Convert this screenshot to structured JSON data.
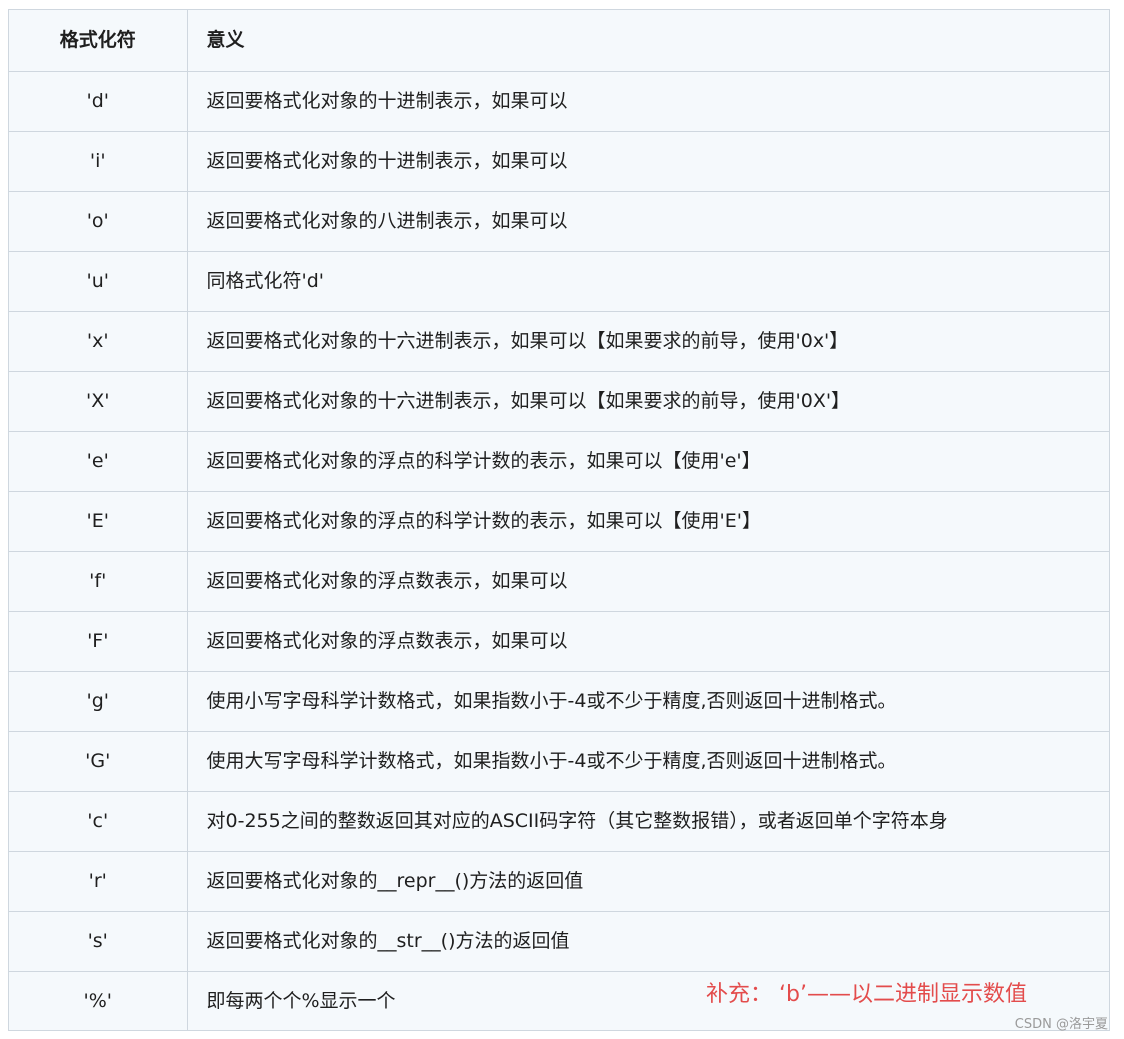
{
  "table": {
    "headers": {
      "format": "格式化符",
      "meaning": "意义"
    },
    "rows": [
      {
        "format": "'d'",
        "meaning": "返回要格式化对象的十进制表示，如果可以"
      },
      {
        "format": "'i'",
        "meaning": "返回要格式化对象的十进制表示，如果可以"
      },
      {
        "format": "'o'",
        "meaning": "返回要格式化对象的八进制表示，如果可以"
      },
      {
        "format": "'u'",
        "meaning": "同格式化符'd'"
      },
      {
        "format": "'x'",
        "meaning": "返回要格式化对象的十六进制表示，如果可以【如果要求的前导，使用'0x'】"
      },
      {
        "format": "'X'",
        "meaning": "返回要格式化对象的十六进制表示，如果可以【如果要求的前导，使用'0X'】"
      },
      {
        "format": "'e'",
        "meaning": "返回要格式化对象的浮点的科学计数的表示，如果可以【使用'e'】"
      },
      {
        "format": "'E'",
        "meaning": "返回要格式化对象的浮点的科学计数的表示，如果可以【使用'E'】"
      },
      {
        "format": "'f'",
        "meaning": "返回要格式化对象的浮点数表示，如果可以"
      },
      {
        "format": "'F'",
        "meaning": "返回要格式化对象的浮点数表示，如果可以"
      },
      {
        "format": "'g'",
        "meaning": "使用小写字母科学计数格式，如果指数小于-4或不少于精度,否则返回十进制格式。"
      },
      {
        "format": "'G'",
        "meaning": "使用大写字母科学计数格式，如果指数小于-4或不少于精度,否则返回十进制格式。"
      },
      {
        "format": "'c'",
        "meaning": "对0-255之间的整数返回其对应的ASCII码字符（其它整数报错），或者返回单个字符本身"
      },
      {
        "format": "'r'",
        "meaning": "返回要格式化对象的__repr__()方法的返回值"
      },
      {
        "format": "'s'",
        "meaning": "返回要格式化对象的__str__()方法的返回值"
      },
      {
        "format": "'%'",
        "meaning": "即每两个个%显示一个"
      }
    ]
  },
  "annotation": {
    "text": "补充：  ‘b’——以二进制显示数值",
    "color": "#e34c4c"
  },
  "watermark": {
    "text": "CSDN @洛宇夏"
  },
  "colors": {
    "table_background": "#f5f9fc",
    "border": "#cfd7df"
  }
}
